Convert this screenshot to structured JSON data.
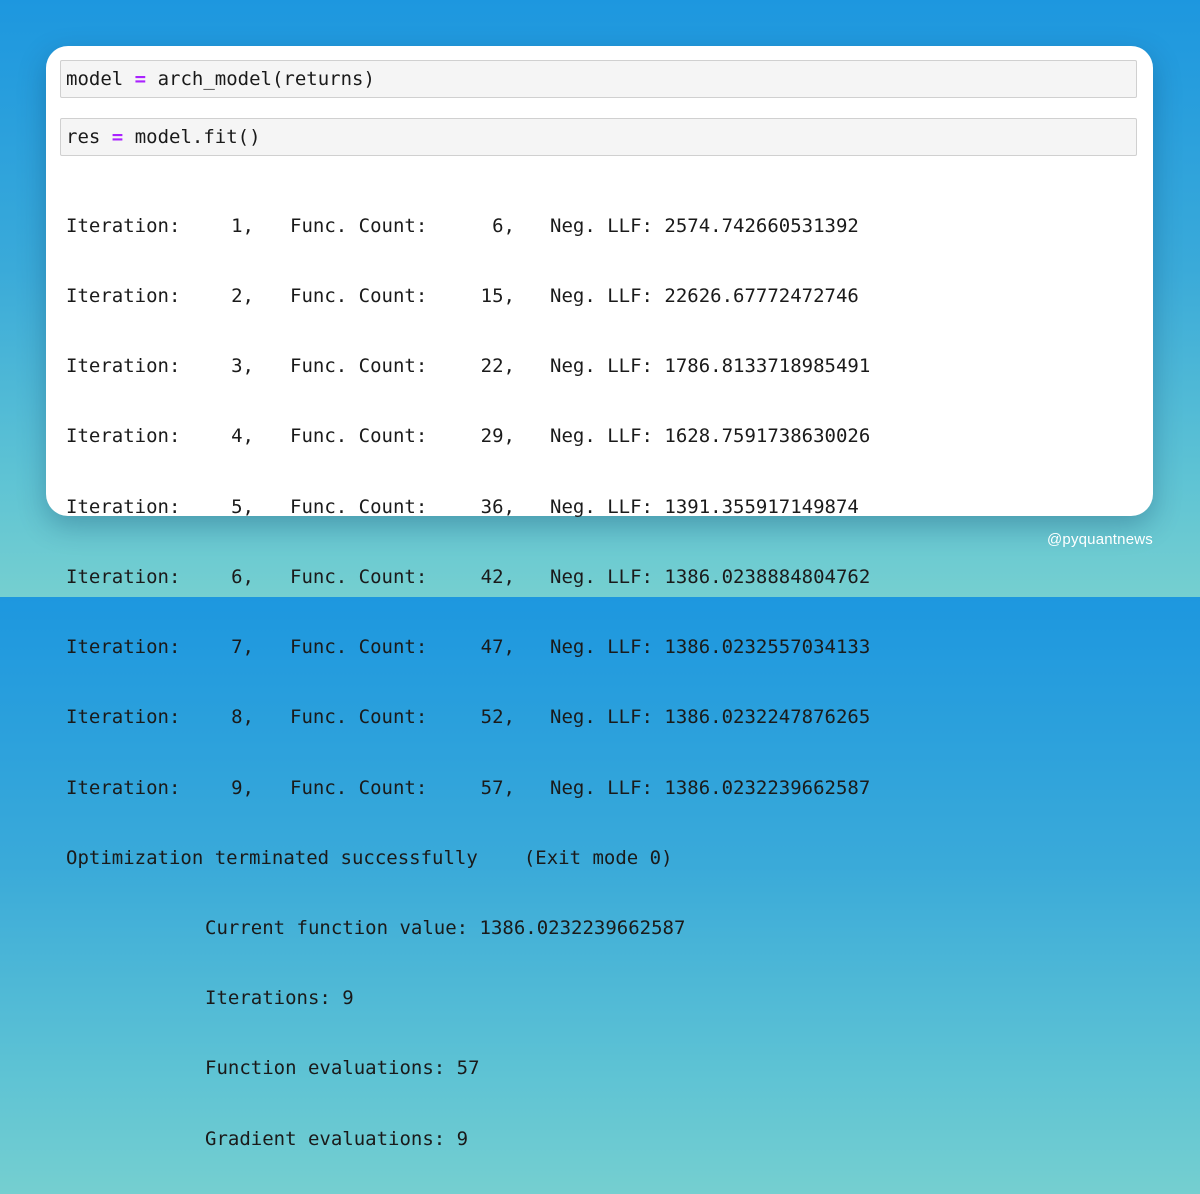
{
  "cells": [
    {
      "lhs": "model",
      "operator": "=",
      "rhs": "arch_model(returns)"
    },
    {
      "lhs": "res",
      "operator": "=",
      "rhs": "model.fit()"
    }
  ],
  "output": {
    "iterations": [
      {
        "label": "Iteration:",
        "iter": "1,",
        "func_label": "Func. Count:",
        "func_count": "6,",
        "llf_label": "Neg. LLF:",
        "llf": "2574.742660531392"
      },
      {
        "label": "Iteration:",
        "iter": "2,",
        "func_label": "Func. Count:",
        "func_count": "15,",
        "llf_label": "Neg. LLF:",
        "llf": "22626.67772472746"
      },
      {
        "label": "Iteration:",
        "iter": "3,",
        "func_label": "Func. Count:",
        "func_count": "22,",
        "llf_label": "Neg. LLF:",
        "llf": "1786.8133718985491"
      },
      {
        "label": "Iteration:",
        "iter": "4,",
        "func_label": "Func. Count:",
        "func_count": "29,",
        "llf_label": "Neg. LLF:",
        "llf": "1628.7591738630026"
      },
      {
        "label": "Iteration:",
        "iter": "5,",
        "func_label": "Func. Count:",
        "func_count": "36,",
        "llf_label": "Neg. LLF:",
        "llf": "1391.355917149874"
      },
      {
        "label": "Iteration:",
        "iter": "6,",
        "func_label": "Func. Count:",
        "func_count": "42,",
        "llf_label": "Neg. LLF:",
        "llf": "1386.0238884804762"
      },
      {
        "label": "Iteration:",
        "iter": "7,",
        "func_label": "Func. Count:",
        "func_count": "47,",
        "llf_label": "Neg. LLF:",
        "llf": "1386.0232557034133"
      },
      {
        "label": "Iteration:",
        "iter": "8,",
        "func_label": "Func. Count:",
        "func_count": "52,",
        "llf_label": "Neg. LLF:",
        "llf": "1386.0232247876265"
      },
      {
        "label": "Iteration:",
        "iter": "9,",
        "func_label": "Func. Count:",
        "func_count": "57,",
        "llf_label": "Neg. LLF:",
        "llf": "1386.0232239662587"
      }
    ],
    "termination": "Optimization terminated successfully",
    "exit_mode": "(Exit mode 0)",
    "summary": [
      "Current function value: 1386.0232239662587",
      "Iterations: 9",
      "Function evaluations: 57",
      "Gradient evaluations: 9"
    ]
  },
  "watermark": "@pyquantnews",
  "colors": {
    "operator": "#aa22ff",
    "code_text": "#1a1a1a",
    "cell_background": "#f5f5f5",
    "card_background": "#ffffff",
    "background_top": "#1d97df",
    "background_bottom": "#75cfd0"
  }
}
